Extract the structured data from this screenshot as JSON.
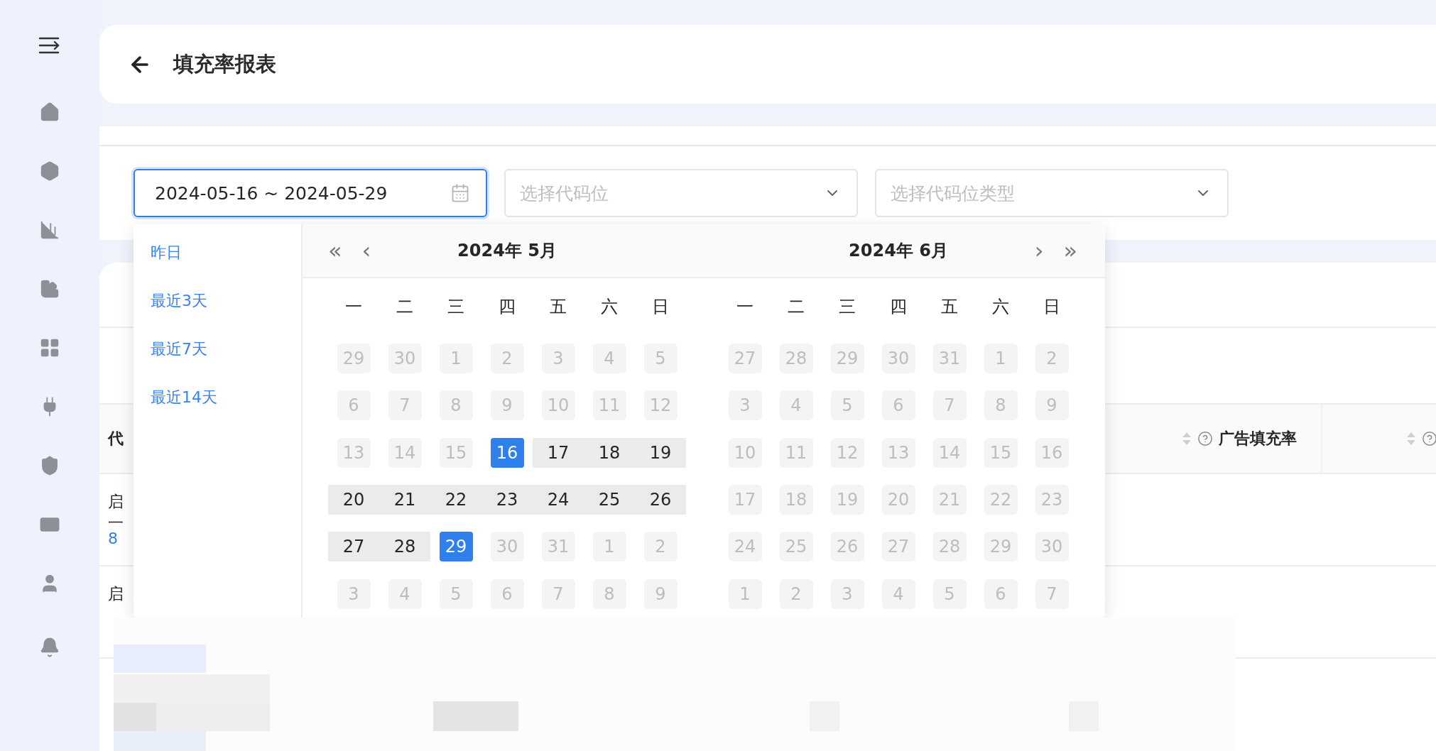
{
  "header": {
    "title": "填充率报表"
  },
  "filters": {
    "date_range": {
      "value": "2024-05-16 ~ 2024-05-29"
    },
    "selects": [
      {
        "placeholder": "选择代码位"
      },
      {
        "placeholder": "选择代码位类型"
      }
    ]
  },
  "table": {
    "columns": [
      {
        "label": "代"
      },
      {
        "label": "广告填充率"
      }
    ],
    "rows": [
      {
        "lines": [
          {
            "text": "启",
            "kind": "text"
          },
          {
            "text": "一",
            "kind": "text"
          },
          {
            "text": "8",
            "kind": "link"
          }
        ]
      },
      {
        "lines": [
          {
            "text": "启",
            "kind": "text"
          }
        ]
      }
    ]
  },
  "date_picker": {
    "presets": [
      "昨日",
      "最近3天",
      "最近7天",
      "最近14天"
    ],
    "nav": {
      "prev_year": "«",
      "prev_month": "‹",
      "next_month": "›",
      "next_year": "»"
    },
    "months": [
      {
        "title": "2024年 5月",
        "weekdays": [
          "一",
          "二",
          "三",
          "四",
          "五",
          "六",
          "日"
        ],
        "weeks": [
          [
            {
              "label": "29",
              "disabled": true,
              "selected": false,
              "in_range": false
            },
            {
              "label": "30",
              "disabled": true,
              "selected": false,
              "in_range": false
            },
            {
              "label": "1",
              "disabled": true,
              "selected": false,
              "in_range": false
            },
            {
              "label": "2",
              "disabled": true,
              "selected": false,
              "in_range": false
            },
            {
              "label": "3",
              "disabled": true,
              "selected": false,
              "in_range": false
            },
            {
              "label": "4",
              "disabled": true,
              "selected": false,
              "in_range": false
            },
            {
              "label": "5",
              "disabled": true,
              "selected": false,
              "in_range": false
            }
          ],
          [
            {
              "label": "6",
              "disabled": true,
              "selected": false,
              "in_range": false
            },
            {
              "label": "7",
              "disabled": true,
              "selected": false,
              "in_range": false
            },
            {
              "label": "8",
              "disabled": true,
              "selected": false,
              "in_range": false
            },
            {
              "label": "9",
              "disabled": true,
              "selected": false,
              "in_range": false
            },
            {
              "label": "10",
              "disabled": true,
              "selected": false,
              "in_range": false
            },
            {
              "label": "11",
              "disabled": true,
              "selected": false,
              "in_range": false
            },
            {
              "label": "12",
              "disabled": true,
              "selected": false,
              "in_range": false
            }
          ],
          [
            {
              "label": "13",
              "disabled": true,
              "selected": false,
              "in_range": false
            },
            {
              "label": "14",
              "disabled": true,
              "selected": false,
              "in_range": false
            },
            {
              "label": "15",
              "disabled": true,
              "selected": false,
              "in_range": false
            },
            {
              "label": "16",
              "disabled": false,
              "selected": true,
              "in_range": true
            },
            {
              "label": "17",
              "disabled": false,
              "selected": false,
              "in_range": true
            },
            {
              "label": "18",
              "disabled": false,
              "selected": false,
              "in_range": true
            },
            {
              "label": "19",
              "disabled": false,
              "selected": false,
              "in_range": true
            }
          ],
          [
            {
              "label": "20",
              "disabled": false,
              "selected": false,
              "in_range": true
            },
            {
              "label": "21",
              "disabled": false,
              "selected": false,
              "in_range": true
            },
            {
              "label": "22",
              "disabled": false,
              "selected": false,
              "in_range": true
            },
            {
              "label": "23",
              "disabled": false,
              "selected": false,
              "in_range": true
            },
            {
              "label": "24",
              "disabled": false,
              "selected": false,
              "in_range": true
            },
            {
              "label": "25",
              "disabled": false,
              "selected": false,
              "in_range": true
            },
            {
              "label": "26",
              "disabled": false,
              "selected": false,
              "in_range": true
            }
          ],
          [
            {
              "label": "27",
              "disabled": false,
              "selected": false,
              "in_range": true
            },
            {
              "label": "28",
              "disabled": false,
              "selected": false,
              "in_range": true
            },
            {
              "label": "29",
              "disabled": false,
              "selected": true,
              "in_range": true
            },
            {
              "label": "30",
              "disabled": true,
              "selected": false,
              "in_range": false
            },
            {
              "label": "31",
              "disabled": true,
              "selected": false,
              "in_range": false
            },
            {
              "label": "1",
              "disabled": true,
              "selected": false,
              "in_range": false
            },
            {
              "label": "2",
              "disabled": true,
              "selected": false,
              "in_range": false
            }
          ],
          [
            {
              "label": "3",
              "disabled": true,
              "selected": false,
              "in_range": false
            },
            {
              "label": "4",
              "disabled": true,
              "selected": false,
              "in_range": false
            },
            {
              "label": "5",
              "disabled": true,
              "selected": false,
              "in_range": false
            },
            {
              "label": "6",
              "disabled": true,
              "selected": false,
              "in_range": false
            },
            {
              "label": "7",
              "disabled": true,
              "selected": false,
              "in_range": false
            },
            {
              "label": "8",
              "disabled": true,
              "selected": false,
              "in_range": false
            },
            {
              "label": "9",
              "disabled": true,
              "selected": false,
              "in_range": false
            }
          ]
        ]
      },
      {
        "title": "2024年 6月",
        "weekdays": [
          "一",
          "二",
          "三",
          "四",
          "五",
          "六",
          "日"
        ],
        "weeks": [
          [
            {
              "label": "27",
              "disabled": true,
              "selected": false,
              "in_range": false
            },
            {
              "label": "28",
              "disabled": true,
              "selected": false,
              "in_range": false
            },
            {
              "label": "29",
              "disabled": true,
              "selected": false,
              "in_range": false
            },
            {
              "label": "30",
              "disabled": true,
              "selected": false,
              "in_range": false
            },
            {
              "label": "31",
              "disabled": true,
              "selected": false,
              "in_range": false
            },
            {
              "label": "1",
              "disabled": true,
              "selected": false,
              "in_range": false
            },
            {
              "label": "2",
              "disabled": true,
              "selected": false,
              "in_range": false
            }
          ],
          [
            {
              "label": "3",
              "disabled": true,
              "selected": false,
              "in_range": false
            },
            {
              "label": "4",
              "disabled": true,
              "selected": false,
              "in_range": false
            },
            {
              "label": "5",
              "disabled": true,
              "selected": false,
              "in_range": false
            },
            {
              "label": "6",
              "disabled": true,
              "selected": false,
              "in_range": false
            },
            {
              "label": "7",
              "disabled": true,
              "selected": false,
              "in_range": false
            },
            {
              "label": "8",
              "disabled": true,
              "selected": false,
              "in_range": false
            },
            {
              "label": "9",
              "disabled": true,
              "selected": false,
              "in_range": false
            }
          ],
          [
            {
              "label": "10",
              "disabled": true,
              "selected": false,
              "in_range": false
            },
            {
              "label": "11",
              "disabled": true,
              "selected": false,
              "in_range": false
            },
            {
              "label": "12",
              "disabled": true,
              "selected": false,
              "in_range": false
            },
            {
              "label": "13",
              "disabled": true,
              "selected": false,
              "in_range": false
            },
            {
              "label": "14",
              "disabled": true,
              "selected": false,
              "in_range": false
            },
            {
              "label": "15",
              "disabled": true,
              "selected": false,
              "in_range": false
            },
            {
              "label": "16",
              "disabled": true,
              "selected": false,
              "in_range": false
            }
          ],
          [
            {
              "label": "17",
              "disabled": true,
              "selected": false,
              "in_range": false
            },
            {
              "label": "18",
              "disabled": true,
              "selected": false,
              "in_range": false
            },
            {
              "label": "19",
              "disabled": true,
              "selected": false,
              "in_range": false
            },
            {
              "label": "20",
              "disabled": true,
              "selected": false,
              "in_range": false
            },
            {
              "label": "21",
              "disabled": true,
              "selected": false,
              "in_range": false
            },
            {
              "label": "22",
              "disabled": true,
              "selected": false,
              "in_range": false
            },
            {
              "label": "23",
              "disabled": true,
              "selected": false,
              "in_range": false
            }
          ],
          [
            {
              "label": "24",
              "disabled": true,
              "selected": false,
              "in_range": false
            },
            {
              "label": "25",
              "disabled": true,
              "selected": false,
              "in_range": false
            },
            {
              "label": "26",
              "disabled": true,
              "selected": false,
              "in_range": false
            },
            {
              "label": "27",
              "disabled": true,
              "selected": false,
              "in_range": false
            },
            {
              "label": "28",
              "disabled": true,
              "selected": false,
              "in_range": false
            },
            {
              "label": "29",
              "disabled": true,
              "selected": false,
              "in_range": false
            },
            {
              "label": "30",
              "disabled": true,
              "selected": false,
              "in_range": false
            }
          ],
          [
            {
              "label": "1",
              "disabled": true,
              "selected": false,
              "in_range": false
            },
            {
              "label": "2",
              "disabled": true,
              "selected": false,
              "in_range": false
            },
            {
              "label": "3",
              "disabled": true,
              "selected": false,
              "in_range": false
            },
            {
              "label": "4",
              "disabled": true,
              "selected": false,
              "in_range": false
            },
            {
              "label": "5",
              "disabled": true,
              "selected": false,
              "in_range": false
            },
            {
              "label": "6",
              "disabled": true,
              "selected": false,
              "in_range": false
            },
            {
              "label": "7",
              "disabled": true,
              "selected": false,
              "in_range": false
            }
          ]
        ]
      }
    ]
  }
}
